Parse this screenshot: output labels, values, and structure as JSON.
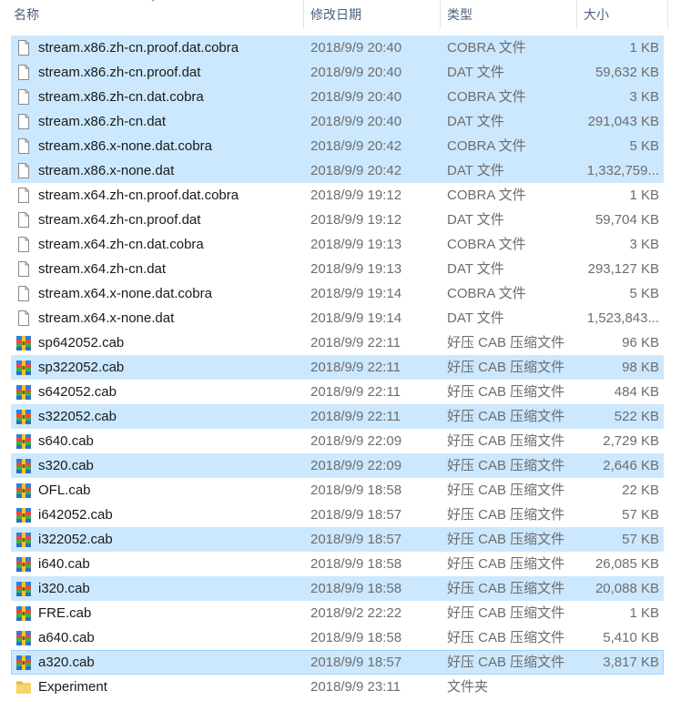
{
  "columns": {
    "name": "名称",
    "date": "修改日期",
    "type": "类型",
    "size": "大小"
  },
  "files": [
    {
      "name": "stream.x86.zh-cn.proof.dat.cobra",
      "date": "2018/9/9 20:40",
      "type": "COBRA 文件",
      "size": "1 KB",
      "icon": "file-icon",
      "selected": true
    },
    {
      "name": "stream.x86.zh-cn.proof.dat",
      "date": "2018/9/9 20:40",
      "type": "DAT 文件",
      "size": "59,632 KB",
      "icon": "file-icon",
      "selected": true
    },
    {
      "name": "stream.x86.zh-cn.dat.cobra",
      "date": "2018/9/9 20:40",
      "type": "COBRA 文件",
      "size": "3 KB",
      "icon": "file-icon",
      "selected": true
    },
    {
      "name": "stream.x86.zh-cn.dat",
      "date": "2018/9/9 20:40",
      "type": "DAT 文件",
      "size": "291,043 KB",
      "icon": "file-icon",
      "selected": true
    },
    {
      "name": "stream.x86.x-none.dat.cobra",
      "date": "2018/9/9 20:42",
      "type": "COBRA 文件",
      "size": "5 KB",
      "icon": "file-icon",
      "selected": true
    },
    {
      "name": "stream.x86.x-none.dat",
      "date": "2018/9/9 20:42",
      "type": "DAT 文件",
      "size": "1,332,759...",
      "icon": "file-icon",
      "selected": true
    },
    {
      "name": "stream.x64.zh-cn.proof.dat.cobra",
      "date": "2018/9/9 19:12",
      "type": "COBRA 文件",
      "size": "1 KB",
      "icon": "file-icon",
      "selected": false
    },
    {
      "name": "stream.x64.zh-cn.proof.dat",
      "date": "2018/9/9 19:12",
      "type": "DAT 文件",
      "size": "59,704 KB",
      "icon": "file-icon",
      "selected": false
    },
    {
      "name": "stream.x64.zh-cn.dat.cobra",
      "date": "2018/9/9 19:13",
      "type": "COBRA 文件",
      "size": "3 KB",
      "icon": "file-icon",
      "selected": false
    },
    {
      "name": "stream.x64.zh-cn.dat",
      "date": "2018/9/9 19:13",
      "type": "DAT 文件",
      "size": "293,127 KB",
      "icon": "file-icon",
      "selected": false
    },
    {
      "name": "stream.x64.x-none.dat.cobra",
      "date": "2018/9/9 19:14",
      "type": "COBRA 文件",
      "size": "5 KB",
      "icon": "file-icon",
      "selected": false
    },
    {
      "name": "stream.x64.x-none.dat",
      "date": "2018/9/9 19:14",
      "type": "DAT 文件",
      "size": "1,523,843...",
      "icon": "file-icon",
      "selected": false
    },
    {
      "name": "sp642052.cab",
      "date": "2018/9/9 22:11",
      "type": "好压 CAB 压缩文件",
      "size": "96 KB",
      "icon": "archive-icon",
      "selected": false
    },
    {
      "name": "sp322052.cab",
      "date": "2018/9/9 22:11",
      "type": "好压 CAB 压缩文件",
      "size": "98 KB",
      "icon": "archive-icon",
      "selected": true
    },
    {
      "name": "s642052.cab",
      "date": "2018/9/9 22:11",
      "type": "好压 CAB 压缩文件",
      "size": "484 KB",
      "icon": "archive-icon",
      "selected": false
    },
    {
      "name": "s322052.cab",
      "date": "2018/9/9 22:11",
      "type": "好压 CAB 压缩文件",
      "size": "522 KB",
      "icon": "archive-icon",
      "selected": true
    },
    {
      "name": "s640.cab",
      "date": "2018/9/9 22:09",
      "type": "好压 CAB 压缩文件",
      "size": "2,729 KB",
      "icon": "archive-icon",
      "selected": false
    },
    {
      "name": "s320.cab",
      "date": "2018/9/9 22:09",
      "type": "好压 CAB 压缩文件",
      "size": "2,646 KB",
      "icon": "archive-icon",
      "selected": true
    },
    {
      "name": "OFL.cab",
      "date": "2018/9/9 18:58",
      "type": "好压 CAB 压缩文件",
      "size": "22 KB",
      "icon": "archive-icon",
      "selected": false
    },
    {
      "name": "i642052.cab",
      "date": "2018/9/9 18:57",
      "type": "好压 CAB 压缩文件",
      "size": "57 KB",
      "icon": "archive-icon",
      "selected": false
    },
    {
      "name": "i322052.cab",
      "date": "2018/9/9 18:57",
      "type": "好压 CAB 压缩文件",
      "size": "57 KB",
      "icon": "archive-icon",
      "selected": true
    },
    {
      "name": "i640.cab",
      "date": "2018/9/9 18:58",
      "type": "好压 CAB 压缩文件",
      "size": "26,085 KB",
      "icon": "archive-icon",
      "selected": false
    },
    {
      "name": "i320.cab",
      "date": "2018/9/9 18:58",
      "type": "好压 CAB 压缩文件",
      "size": "20,088 KB",
      "icon": "archive-icon",
      "selected": true
    },
    {
      "name": "FRE.cab",
      "date": "2018/9/2 22:22",
      "type": "好压 CAB 压缩文件",
      "size": "1 KB",
      "icon": "archive-icon",
      "selected": false
    },
    {
      "name": "a640.cab",
      "date": "2018/9/9 18:58",
      "type": "好压 CAB 压缩文件",
      "size": "5,410 KB",
      "icon": "archive-icon",
      "selected": false
    },
    {
      "name": "a320.cab",
      "date": "2018/9/9 18:57",
      "type": "好压 CAB 压缩文件",
      "size": "3,817 KB",
      "icon": "archive-icon",
      "selected": true,
      "focused": true
    },
    {
      "name": "Experiment",
      "date": "2018/9/9 23:11",
      "type": "文件夹",
      "size": "",
      "icon": "folder-icon",
      "selected": false
    }
  ],
  "colors": {
    "selection": "#cce8ff",
    "focus_border": "#99d1ff",
    "header_text": "#4c607a",
    "secondary_text": "#6d6d6d"
  }
}
